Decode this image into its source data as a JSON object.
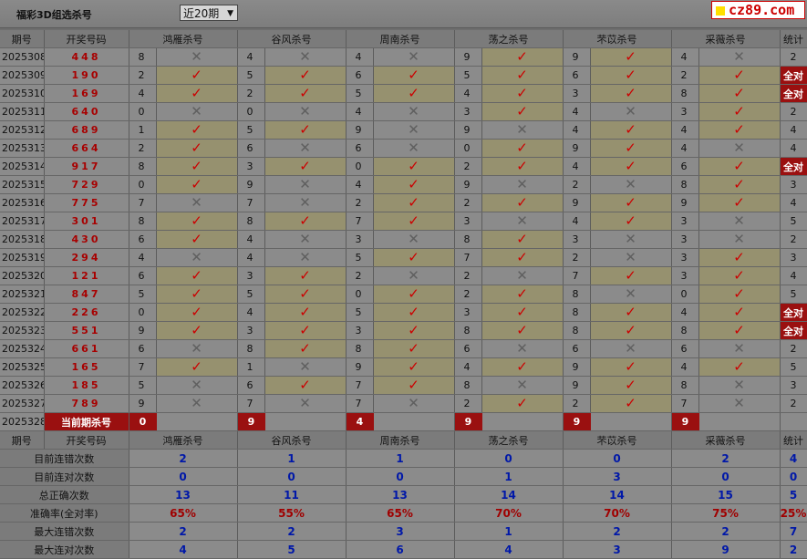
{
  "header": {
    "title": "福彩3D组选杀号",
    "period_select": "近20期",
    "logo": "cz89.com"
  },
  "columns": {
    "period": "期号",
    "draw": "开奖号码",
    "total": "统计"
  },
  "experts": [
    "鸿雁杀号",
    "谷风杀号",
    "周南杀号",
    "荡之杀号",
    "芣苡杀号",
    "采薇杀号"
  ],
  "rows": [
    {
      "period": "2025308",
      "draw": "448",
      "kills": [
        [
          "8",
          "x"
        ],
        [
          "4",
          "x"
        ],
        [
          "4",
          "x"
        ],
        [
          "9",
          "v"
        ],
        [
          "9",
          "v"
        ],
        [
          "4",
          "x"
        ]
      ],
      "total": "2"
    },
    {
      "period": "2025309",
      "draw": "190",
      "kills": [
        [
          "2",
          "v"
        ],
        [
          "5",
          "v"
        ],
        [
          "6",
          "v"
        ],
        [
          "5",
          "v"
        ],
        [
          "6",
          "v"
        ],
        [
          "2",
          "v"
        ]
      ],
      "total": "全对"
    },
    {
      "period": "2025310",
      "draw": "169",
      "kills": [
        [
          "4",
          "v"
        ],
        [
          "2",
          "v"
        ],
        [
          "5",
          "v"
        ],
        [
          "4",
          "v"
        ],
        [
          "3",
          "v"
        ],
        [
          "8",
          "v"
        ]
      ],
      "total": "全对"
    },
    {
      "period": "2025311",
      "draw": "640",
      "kills": [
        [
          "0",
          "x"
        ],
        [
          "0",
          "x"
        ],
        [
          "4",
          "x"
        ],
        [
          "3",
          "v"
        ],
        [
          "4",
          "x"
        ],
        [
          "3",
          "v"
        ]
      ],
      "total": "2"
    },
    {
      "period": "2025312",
      "draw": "689",
      "kills": [
        [
          "1",
          "v"
        ],
        [
          "5",
          "v"
        ],
        [
          "9",
          "x"
        ],
        [
          "9",
          "x"
        ],
        [
          "4",
          "v"
        ],
        [
          "4",
          "v"
        ]
      ],
      "total": "4"
    },
    {
      "period": "2025313",
      "draw": "664",
      "kills": [
        [
          "2",
          "v"
        ],
        [
          "6",
          "x"
        ],
        [
          "6",
          "x"
        ],
        [
          "0",
          "v"
        ],
        [
          "9",
          "v"
        ],
        [
          "4",
          "x"
        ]
      ],
      "total": "4"
    },
    {
      "period": "2025314",
      "draw": "917",
      "kills": [
        [
          "8",
          "v"
        ],
        [
          "3",
          "v"
        ],
        [
          "0",
          "v"
        ],
        [
          "2",
          "v"
        ],
        [
          "4",
          "v"
        ],
        [
          "6",
          "v"
        ]
      ],
      "total": "全对"
    },
    {
      "period": "2025315",
      "draw": "729",
      "kills": [
        [
          "0",
          "v"
        ],
        [
          "9",
          "x"
        ],
        [
          "4",
          "v"
        ],
        [
          "9",
          "x"
        ],
        [
          "2",
          "x"
        ],
        [
          "8",
          "v"
        ]
      ],
      "total": "3"
    },
    {
      "period": "2025316",
      "draw": "775",
      "kills": [
        [
          "7",
          "x"
        ],
        [
          "7",
          "x"
        ],
        [
          "2",
          "v"
        ],
        [
          "2",
          "v"
        ],
        [
          "9",
          "v"
        ],
        [
          "9",
          "v"
        ]
      ],
      "total": "4"
    },
    {
      "period": "2025317",
      "draw": "301",
      "kills": [
        [
          "8",
          "v"
        ],
        [
          "8",
          "v"
        ],
        [
          "7",
          "v"
        ],
        [
          "3",
          "x"
        ],
        [
          "4",
          "v"
        ],
        [
          "3",
          "x"
        ]
      ],
      "total": "5"
    },
    {
      "period": "2025318",
      "draw": "430",
      "kills": [
        [
          "6",
          "v"
        ],
        [
          "4",
          "x"
        ],
        [
          "3",
          "x"
        ],
        [
          "8",
          "v"
        ],
        [
          "3",
          "x"
        ],
        [
          "3",
          "x"
        ]
      ],
      "total": "2"
    },
    {
      "period": "2025319",
      "draw": "294",
      "kills": [
        [
          "4",
          "x"
        ],
        [
          "4",
          "x"
        ],
        [
          "5",
          "v"
        ],
        [
          "7",
          "v"
        ],
        [
          "2",
          "x"
        ],
        [
          "3",
          "v"
        ]
      ],
      "total": "3"
    },
    {
      "period": "2025320",
      "draw": "121",
      "kills": [
        [
          "6",
          "v"
        ],
        [
          "3",
          "v"
        ],
        [
          "2",
          "x"
        ],
        [
          "2",
          "x"
        ],
        [
          "7",
          "v"
        ],
        [
          "3",
          "v"
        ]
      ],
      "total": "4"
    },
    {
      "period": "2025321",
      "draw": "847",
      "kills": [
        [
          "5",
          "v"
        ],
        [
          "5",
          "v"
        ],
        [
          "0",
          "v"
        ],
        [
          "2",
          "v"
        ],
        [
          "8",
          "x"
        ],
        [
          "0",
          "v"
        ]
      ],
      "total": "5"
    },
    {
      "period": "2025322",
      "draw": "226",
      "kills": [
        [
          "0",
          "v"
        ],
        [
          "4",
          "v"
        ],
        [
          "5",
          "v"
        ],
        [
          "3",
          "v"
        ],
        [
          "8",
          "v"
        ],
        [
          "4",
          "v"
        ]
      ],
      "total": "全对"
    },
    {
      "period": "2025323",
      "draw": "551",
      "kills": [
        [
          "9",
          "v"
        ],
        [
          "3",
          "v"
        ],
        [
          "3",
          "v"
        ],
        [
          "8",
          "v"
        ],
        [
          "8",
          "v"
        ],
        [
          "8",
          "v"
        ]
      ],
      "total": "全对"
    },
    {
      "period": "2025324",
      "draw": "661",
      "kills": [
        [
          "6",
          "x"
        ],
        [
          "8",
          "v"
        ],
        [
          "8",
          "v"
        ],
        [
          "6",
          "x"
        ],
        [
          "6",
          "x"
        ],
        [
          "6",
          "x"
        ]
      ],
      "total": "2"
    },
    {
      "period": "2025325",
      "draw": "165",
      "kills": [
        [
          "7",
          "v"
        ],
        [
          "1",
          "x"
        ],
        [
          "9",
          "v"
        ],
        [
          "4",
          "v"
        ],
        [
          "9",
          "v"
        ],
        [
          "4",
          "v"
        ]
      ],
      "total": "5"
    },
    {
      "period": "2025326",
      "draw": "185",
      "kills": [
        [
          "5",
          "x"
        ],
        [
          "6",
          "v"
        ],
        [
          "7",
          "v"
        ],
        [
          "8",
          "x"
        ],
        [
          "9",
          "v"
        ],
        [
          "8",
          "x"
        ]
      ],
      "total": "3"
    },
    {
      "period": "2025327",
      "draw": "789",
      "kills": [
        [
          "9",
          "x"
        ],
        [
          "7",
          "x"
        ],
        [
          "7",
          "x"
        ],
        [
          "2",
          "v"
        ],
        [
          "2",
          "v"
        ],
        [
          "7",
          "x"
        ]
      ],
      "total": "2"
    }
  ],
  "current": {
    "period": "2025328",
    "label": "当前期杀号",
    "kills": [
      "0",
      "9",
      "4",
      "9",
      "9",
      "9"
    ]
  },
  "stats": [
    {
      "label": "目前连错次数",
      "values": [
        "2",
        "1",
        "1",
        "0",
        "0",
        "2"
      ],
      "total": "4"
    },
    {
      "label": "目前连对次数",
      "values": [
        "0",
        "0",
        "0",
        "1",
        "3",
        "0"
      ],
      "total": "0"
    },
    {
      "label": "总正确次数",
      "values": [
        "13",
        "11",
        "13",
        "14",
        "14",
        "15"
      ],
      "total": "5"
    },
    {
      "label": "准确率(全对率)",
      "values": [
        "65%",
        "55%",
        "65%",
        "70%",
        "70%",
        "75%"
      ],
      "total": "25%",
      "percent": true
    },
    {
      "label": "最大连错次数",
      "values": [
        "2",
        "2",
        "3",
        "1",
        "2",
        "2"
      ],
      "total": "7"
    },
    {
      "label": "最大连对次数",
      "values": [
        "4",
        "5",
        "6",
        "4",
        "3",
        "9"
      ],
      "total": "2"
    }
  ],
  "icons": {
    "wrong": "cross-mark-icon",
    "right": "check-mark-icon"
  },
  "colors": {
    "accent_red": "#9a1010",
    "draw_red": "#a80000",
    "stat_blue": "#0018a8"
  }
}
